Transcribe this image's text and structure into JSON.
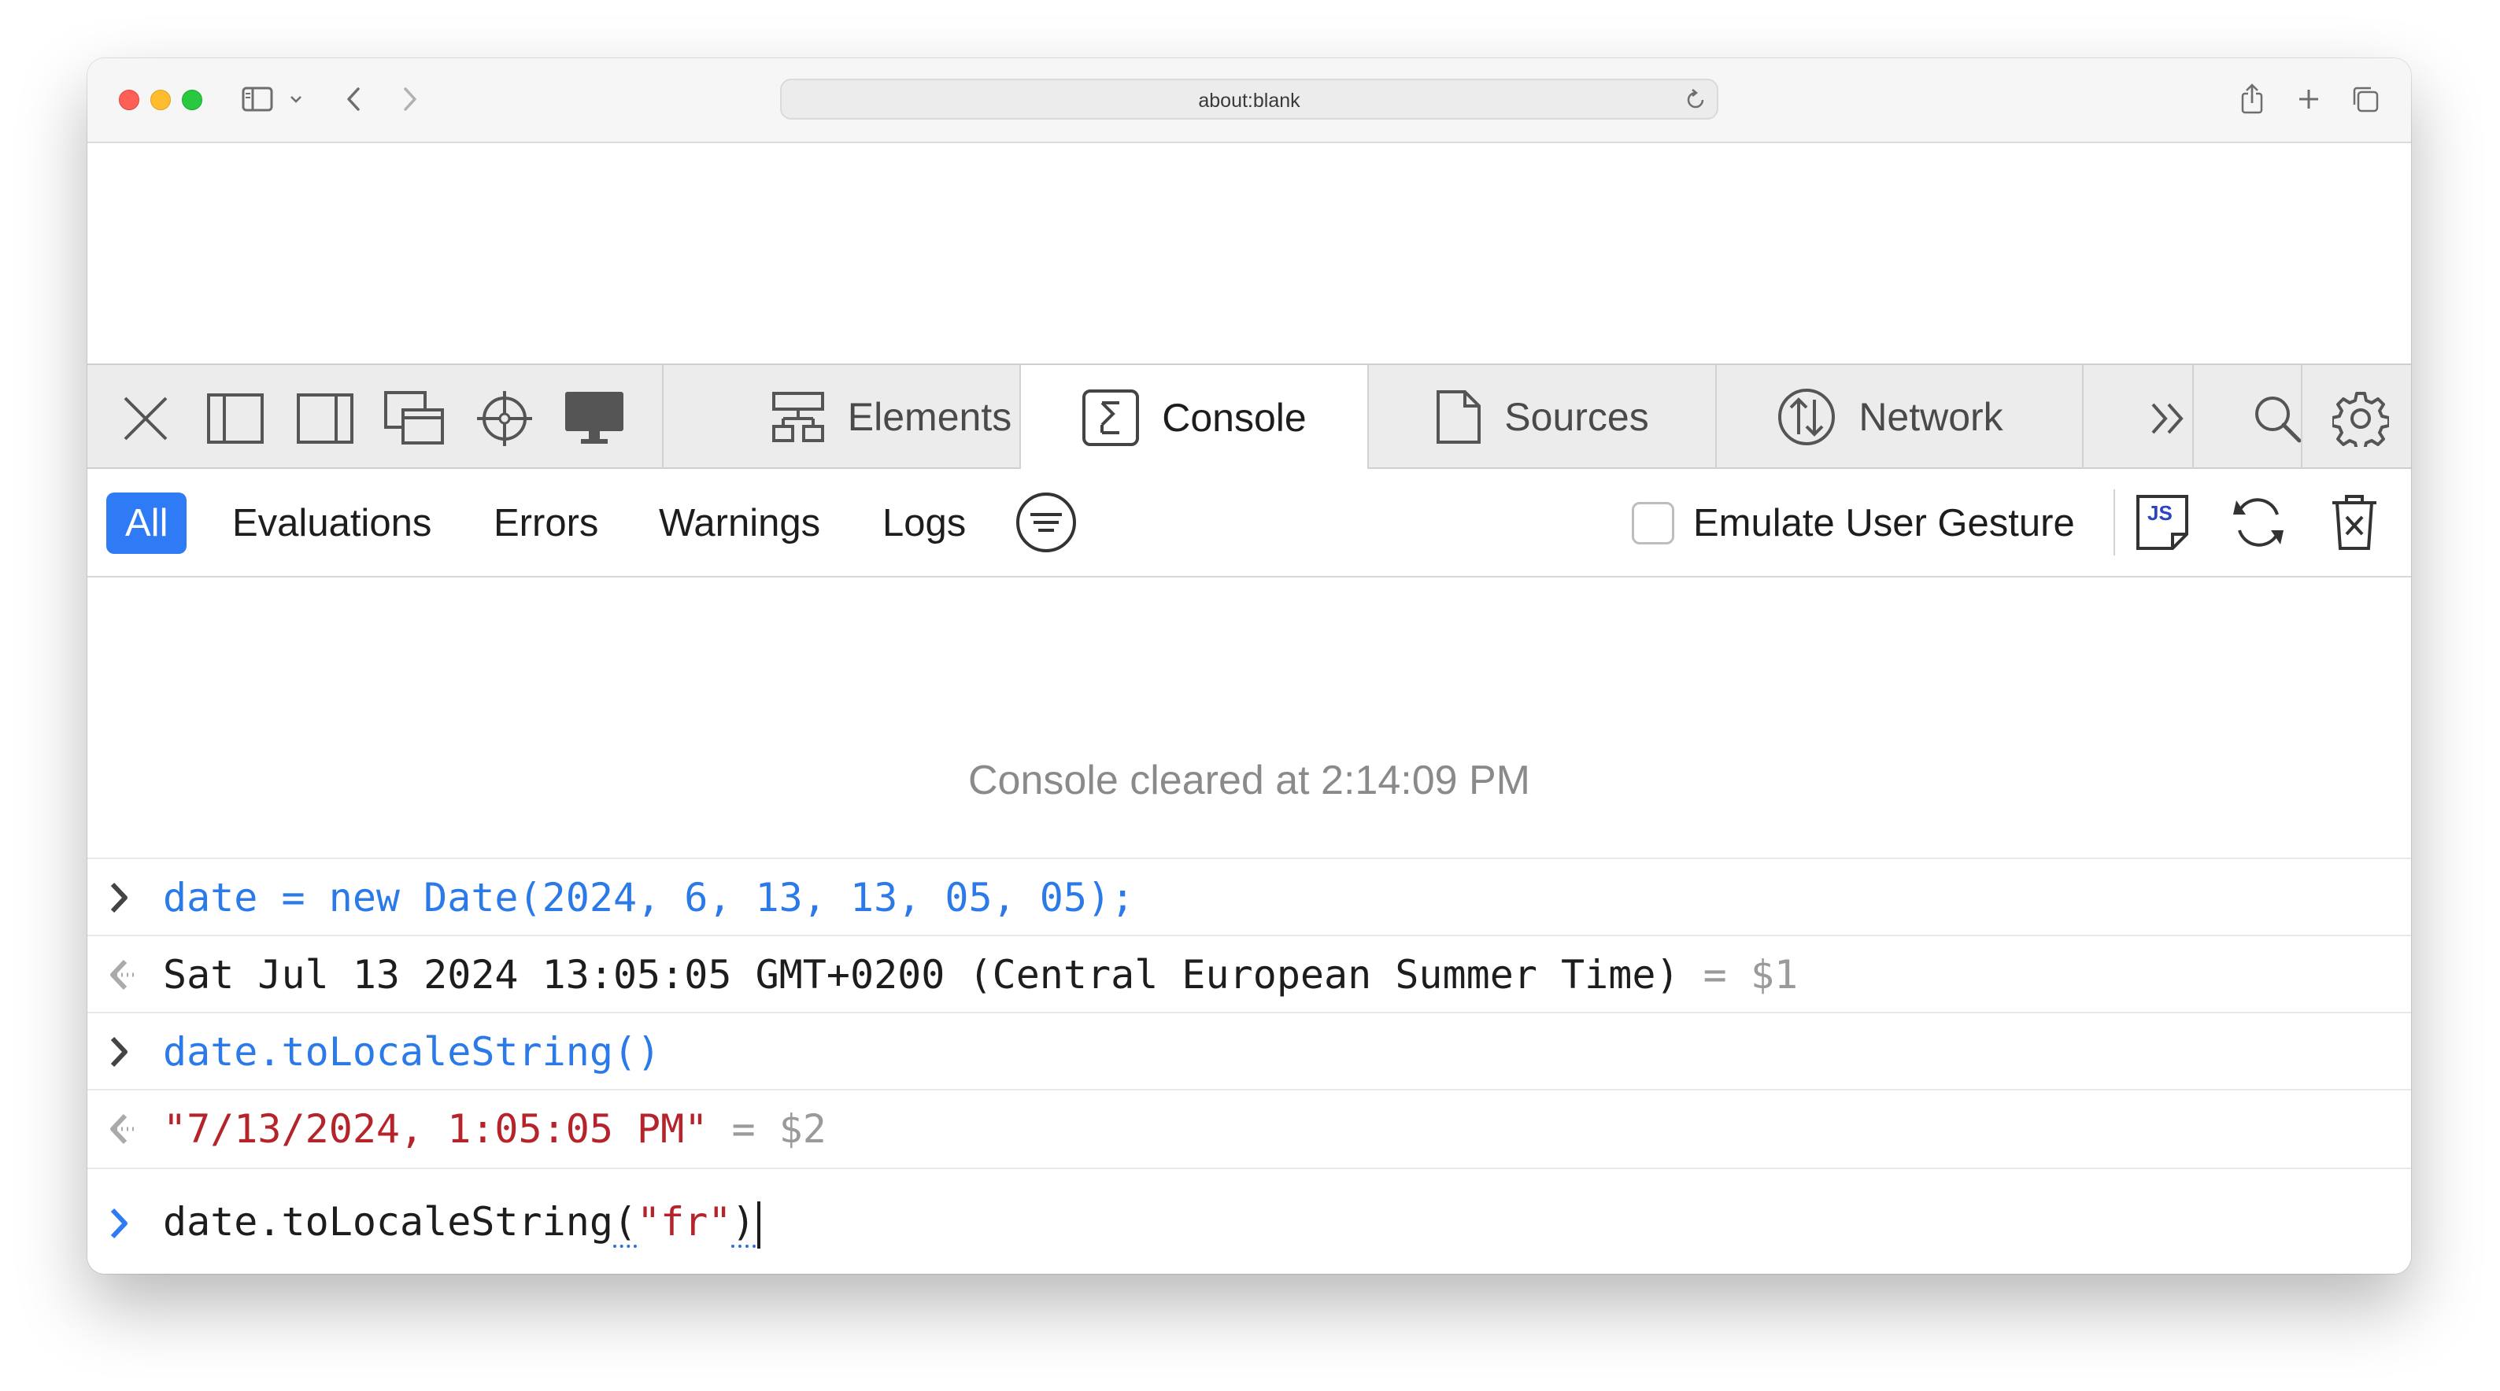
{
  "browser": {
    "address": "about:blank"
  },
  "devtools": {
    "tabs": [
      {
        "label": "Elements",
        "icon": "elements-icon"
      },
      {
        "label": "Console",
        "icon": "console-icon",
        "active": true
      },
      {
        "label": "Sources",
        "icon": "sources-icon"
      },
      {
        "label": "Network",
        "icon": "network-icon"
      }
    ]
  },
  "filters": {
    "items": [
      "All",
      "Evaluations",
      "Errors",
      "Warnings",
      "Logs"
    ],
    "active": "All",
    "emulate_label": "Emulate User Gesture",
    "js_badge": "JS"
  },
  "console": {
    "cleared": "Console cleared at 2:14:09 PM",
    "entries": [
      {
        "type": "input",
        "text": "date = new Date(2024, 6, 13, 13, 05, 05);"
      },
      {
        "type": "output",
        "text": "Sat Jul 13 2024 13:05:05 GMT+0200 (Central European Summer Time)",
        "ref": "= $1"
      },
      {
        "type": "input",
        "text": "date.toLocaleString()"
      },
      {
        "type": "output",
        "text": "\"7/13/2024, 1:05:05 PM\"",
        "ref": "= $2"
      }
    ],
    "prompt": {
      "prefix": "date.toLocaleString",
      "open": "(",
      "arg": "\"fr\"",
      "close": ")"
    }
  },
  "colors": {
    "accent": "#2f7bf5",
    "input_text": "#2b7ae8",
    "string_output": "#b5232b"
  }
}
